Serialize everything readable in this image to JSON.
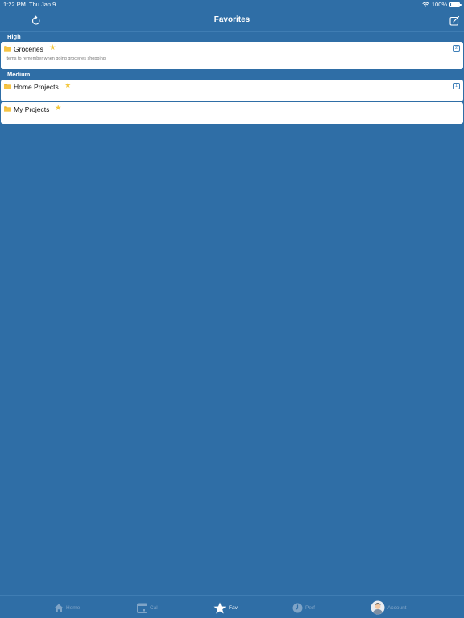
{
  "status": {
    "time": "1:22 PM",
    "date": "Thu Jan 9",
    "battery": "100%"
  },
  "nav": {
    "title": "Favorites"
  },
  "sections": [
    {
      "label": "High"
    },
    {
      "label": "Medium"
    }
  ],
  "items": [
    {
      "name": "Groceries",
      "description": "Items to remember when going groceries shopping",
      "count": "2"
    },
    {
      "name": "Home Projects",
      "count": "1"
    },
    {
      "name": "My Projects"
    }
  ],
  "tabs": [
    {
      "label": "Home",
      "icon": "home-icon"
    },
    {
      "label": "Cal",
      "icon": "calendar-icon"
    },
    {
      "label": "Fav",
      "icon": "star-icon"
    },
    {
      "label": "Perf",
      "icon": "clock-icon"
    },
    {
      "label": "Account",
      "icon": "avatar-icon"
    }
  ],
  "colors": {
    "background": "#2f6ea6",
    "star": "#f3c73e",
    "folder": "#f0b429",
    "badge": "#3e7fb8",
    "inactive_tab": "#7fa4c7"
  }
}
